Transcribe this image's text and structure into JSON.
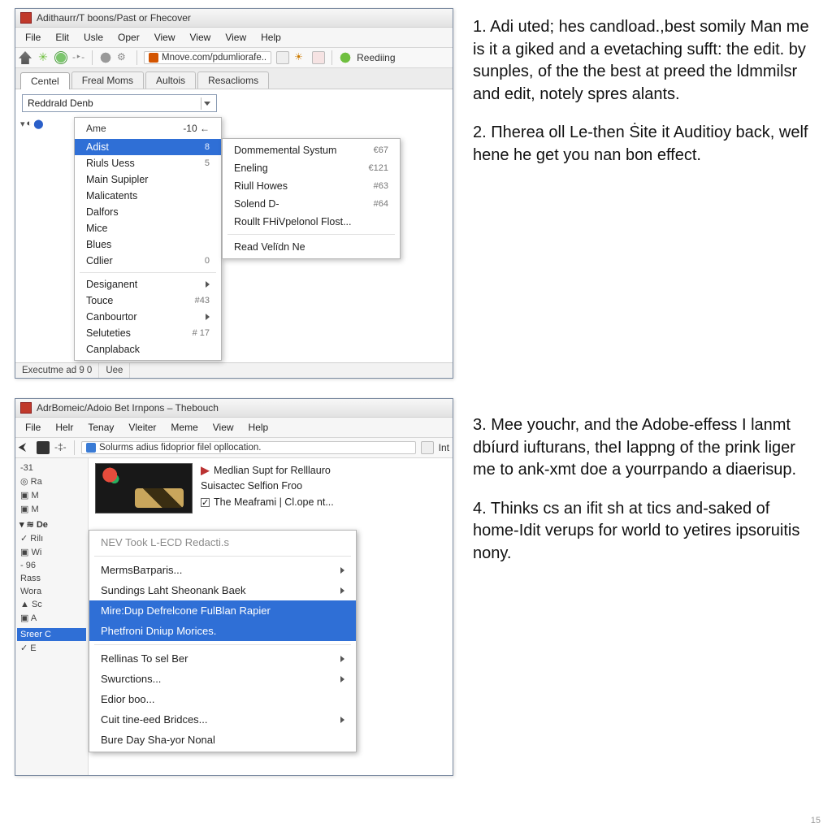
{
  "page_number": "15",
  "window1": {
    "title": "Adithaurr/T boons/Past or Fhecover",
    "menubar": [
      "File",
      "Elit",
      "Usle",
      "Oper",
      "View",
      "View",
      "View",
      "Help"
    ],
    "toolbar": {
      "addr_text": "Mnove.com/pdumliorafe..",
      "reediing": "Reediing"
    },
    "tabs": [
      "Centel",
      "Freal Moms",
      "Aultois",
      "Resaclioms"
    ],
    "dropdown_value": "Reddrald Denb",
    "side_icons_text": "▾ ◑ ⬤",
    "main_menu": {
      "header_left": "Ame",
      "header_right": "-10 ←",
      "items": [
        {
          "label": "Adist",
          "code": "8",
          "selected": true
        },
        {
          "label": "Riuls Uess",
          "code": "5"
        },
        {
          "label": "Main Supipler",
          "code": ""
        },
        {
          "label": "Malicatents",
          "code": ""
        },
        {
          "label": "Dalfors",
          "code": ""
        },
        {
          "label": "Mice",
          "code": ""
        },
        {
          "label": "Blues",
          "code": ""
        },
        {
          "label": "Cdlier",
          "code": "0"
        }
      ],
      "sep_items": [
        {
          "label": "Desiganent",
          "arrow": true
        },
        {
          "label": "Touce",
          "code": "#43"
        },
        {
          "label": "Canbourtor",
          "arrow": true
        },
        {
          "label": "Seluteties",
          "code": "# 17"
        },
        {
          "label": "Canplaback",
          "code": ""
        }
      ]
    },
    "submenu": {
      "items": [
        {
          "label": "Dommemental Systum",
          "code": "€67"
        },
        {
          "label": "Eneling",
          "code": "€121"
        },
        {
          "label": "Riull Howes",
          "code": "#63"
        },
        {
          "label": "Solend D-",
          "code": "#64"
        },
        {
          "label": "Roullt FHiVpelonol Flost...",
          "code": ""
        }
      ],
      "sep_item": {
        "label": "Read Velïdn Ne"
      }
    },
    "status": [
      "Executme ad 9 0",
      "Uee"
    ]
  },
  "window2": {
    "title": "AdrBomeic/Adoio Bet Irnpons – Thebouch",
    "menubar": [
      "File",
      "Helr",
      "Tenay",
      "Vleiter",
      "Meme",
      "View",
      "Help"
    ],
    "toolbar": {
      "addr_text": "Solurms adius fidoprior filel opllocation.",
      "right_label": "Int"
    },
    "thumb_lines": [
      {
        "icon": "#b33",
        "label": "Medlian Supt for Relllauro"
      },
      {
        "icon": "",
        "label": "Suisactec Selfion Froo"
      },
      {
        "icon": "#222",
        "label": "The Meaframi | Cl.ope nt...",
        "check": true
      }
    ],
    "leftpane": {
      "items": [
        "-31",
        "◎ Ra",
        "▣ M",
        "▣ M"
      ],
      "group_head": "▾ ≋ De",
      "group_items": [
        "✓ Rilı",
        "▣ Wi"
      ],
      "items2": [
        "- 96",
        "Rass",
        "Wora",
        "▲ Sc",
        "▣ A"
      ],
      "footer": "Sreer C",
      "footer2": "✓ E"
    },
    "popup": {
      "items": [
        {
          "label": "NEV Took L-ECD Redacti.s",
          "gray": true
        },
        {
          "sep": true
        },
        {
          "label": "MermsВатparis...",
          "arrow": true
        },
        {
          "label": "Sundings Laht Sheonank Baek",
          "arrow": true
        },
        {
          "label": "Mire:Dup Defrelcone FulBlan Rapier",
          "selected": true
        },
        {
          "label": "Phetfroni Dniup Morices.",
          "selected": true
        },
        {
          "sep": true
        },
        {
          "label": "Rellinas To sel Ber",
          "arrow": true
        },
        {
          "label": "Swurctions...",
          "arrow": true
        },
        {
          "label": "Edior boo..."
        },
        {
          "label": "Cuit tine-eed Bridces...",
          "arrow": true
        },
        {
          "label": "Bure Day Sha-yor Nonal"
        }
      ]
    }
  },
  "right_text": {
    "p1": "1. Adi uted; hes candload.,best somily Man me is it a giked and a evetaching sufft: the edit. by sunples, of the the best at preed the ldmmilsr and edit, notely spres alants.",
    "p2": "2. Πherea oll Le-then Ṡite it Auditioy back, welf hene he get you nan bon effect.",
    "p3": "3. Mee youchr, and the Adobe-effess I lanmt dbíurd iufturans, theI lappng of the prink liger me to ank-xmt doe a yourrpando a diaerisup.",
    "p4": "4. Thinks cs an ifit sh at tics and-saked of home-Idit verups for world to yetires ipsoruitis nony."
  }
}
